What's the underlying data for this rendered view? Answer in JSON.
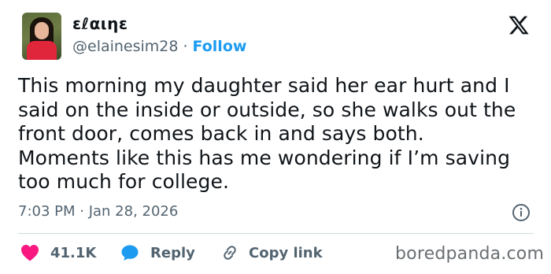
{
  "author": {
    "display_name": "ɛℓαιηɛ",
    "handle": "@elainesim28",
    "separator": "·",
    "follow_label": "Follow"
  },
  "tweet": {
    "lines": [
      "This morning my daughter said her ear hurt and I",
      "said on the inside or outside, so she walks out the",
      "front door, comes back in and says both.",
      "Moments like this has me wondering if I’m saving",
      "too much for college."
    ],
    "timestamp": "7:03 PM · Jan 28, 2026"
  },
  "actions": {
    "like_count": "41.1K",
    "reply_label": "Reply",
    "copy_label": "Copy link"
  },
  "watermark": "boredpanda.com",
  "colors": {
    "like": "#f91880",
    "reply": "#1d9bf0",
    "follow": "#1d9bf0",
    "secondary_text": "#536471"
  },
  "icons": [
    "x-logo-icon",
    "info-icon",
    "heart-icon",
    "reply-bubble-icon",
    "link-icon"
  ]
}
